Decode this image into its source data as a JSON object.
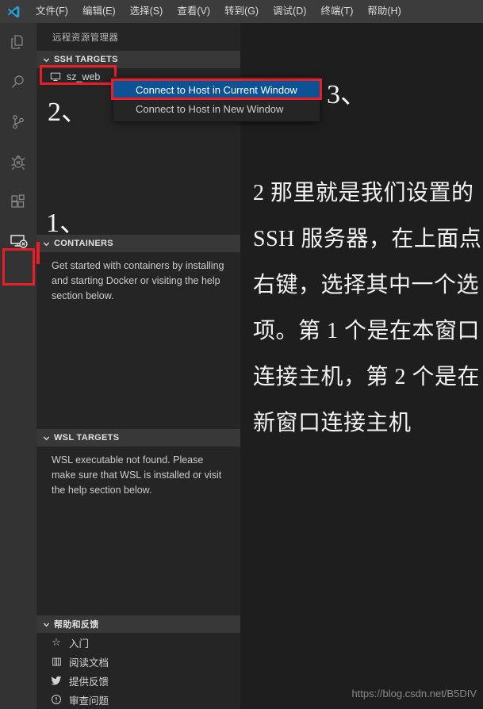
{
  "colors": {
    "accent_red": "#ee1c25",
    "menu_selected_blue": "#0b5394",
    "titlebar_bg": "#3c3c3c",
    "activitybar_bg": "#333333",
    "sidebar_bg": "#252526",
    "editor_bg": "#1e1e1e",
    "section_header_bg": "#383838"
  },
  "menubar": {
    "logo_icon": "vscode-logo-icon",
    "items": [
      {
        "label": "文件(F)"
      },
      {
        "label": "编辑(E)"
      },
      {
        "label": "选择(S)"
      },
      {
        "label": "查看(V)"
      },
      {
        "label": "转到(G)"
      },
      {
        "label": "调试(D)"
      },
      {
        "label": "终端(T)"
      },
      {
        "label": "帮助(H)"
      }
    ]
  },
  "activitybar": {
    "items": [
      {
        "name": "explorer-icon",
        "title": "资源管理器",
        "active": false
      },
      {
        "name": "search-icon",
        "title": "搜索",
        "active": false
      },
      {
        "name": "source-control-icon",
        "title": "源代码管理",
        "active": false
      },
      {
        "name": "debug-icon",
        "title": "调试",
        "active": false
      },
      {
        "name": "extensions-icon",
        "title": "扩展",
        "active": false
      },
      {
        "name": "remote-explorer-icon",
        "title": "远程资源管理器",
        "active": true
      }
    ]
  },
  "sidebar": {
    "title": "远程资源管理器",
    "sections": {
      "ssh_targets": {
        "header": "SSH TARGETS",
        "expanded": true,
        "items": [
          {
            "label": "sz_web",
            "icon": "monitor-icon",
            "highlighted": true
          }
        ]
      },
      "containers": {
        "header": "CONTAINERS",
        "expanded": true,
        "body": "Get started with containers by installing and starting Docker or visiting the help section below."
      },
      "wsl_targets": {
        "header": "WSL TARGETS",
        "expanded": true,
        "body": "WSL executable not found. Please make sure that WSL is installed or visit the help section below."
      },
      "help_feedback": {
        "header": "帮助和反馈",
        "expanded": true,
        "items": [
          {
            "label": "入门",
            "icon": "star-icon"
          },
          {
            "label": "阅读文档",
            "icon": "book-icon"
          },
          {
            "label": "提供反馈",
            "icon": "twitter-icon"
          },
          {
            "label": "审查问题",
            "icon": "issue-icon"
          }
        ]
      }
    }
  },
  "context_menu": {
    "items": [
      {
        "label": "Connect to Host in Current Window",
        "selected": true
      },
      {
        "label": "Connect to Host in New Window",
        "selected": false
      }
    ]
  },
  "annotation": {
    "text": "2 那里就是我们设置的 SSH 服务器，在上面点右键，选择其中一个选项。第 1 个是在本窗口连接主机，第 2 个是在新窗口连接主机",
    "marks": [
      {
        "label": "1、"
      },
      {
        "label": "2、"
      },
      {
        "label": "3、"
      }
    ]
  },
  "watermark": "https://blog.csdn.net/B5DIV"
}
